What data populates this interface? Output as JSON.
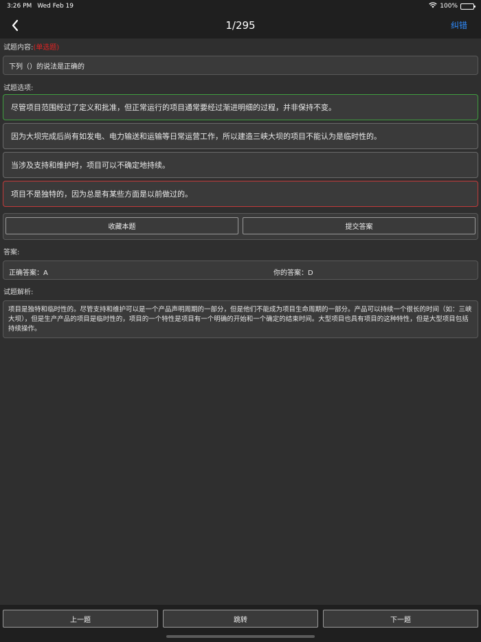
{
  "status_bar": {
    "time": "3:26 PM",
    "date": "Wed Feb 19",
    "battery": "100%"
  },
  "nav": {
    "title": "1/295",
    "report_label": "纠错"
  },
  "question": {
    "content_label": "试题内容:",
    "type_tag": "(单选题)",
    "text": "下列（）的说法是正确的"
  },
  "options_label": "试题选项:",
  "options": [
    {
      "text": "尽管项目范围经过了定义和批准，但正常运行的项目通常要经过渐进明细的过程，并非保持不变。",
      "state": "correct"
    },
    {
      "text": "因为大坝完成后尚有如发电、电力输送和运输等日常运营工作，所以建造三峡大坝的项目不能认为是临时性的。",
      "state": "normal"
    },
    {
      "text": "当涉及支持和维护时，项目可以不确定地持续。",
      "state": "normal"
    },
    {
      "text": "项目不是独特的，因为总是有某些方面是以前做过的。",
      "state": "wrong"
    }
  ],
  "actions": {
    "favorite_label": "收藏本题",
    "submit_label": "提交答案"
  },
  "answer": {
    "label": "答案:",
    "correct_label": "正确答案：",
    "correct_value": "A",
    "yours_label": "你的答案：",
    "yours_value": "D"
  },
  "analysis": {
    "label": "试题解析:",
    "text": "项目是独特和临时性的。尽管支持和维护可以是一个产品声明周期的一部分，但是他们不能成为项目生命周期的一部分。产品可以持续一个很长的时间（如：三峡大坝），但是生产产品的项目是临时性的，项目的一个特性是项目有一个明确的开始和一个确定的结束时间。大型项目也具有项目的这种特性，但是大型项目包括持续操作。"
  },
  "bottom_nav": {
    "prev_label": "上一题",
    "jump_label": "跳转",
    "next_label": "下一题"
  },
  "colors": {
    "accent": "#2f8cff",
    "correct_border": "#3f9e3f",
    "wrong_border": "#c23a3a",
    "tag_red": "#e02424"
  }
}
